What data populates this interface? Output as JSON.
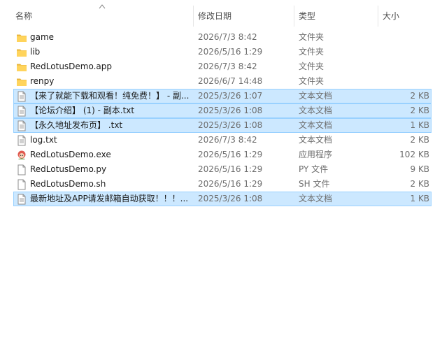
{
  "columns": {
    "name": "名称",
    "date": "修改日期",
    "type": "类型",
    "size": "大小"
  },
  "files": [
    {
      "name": "game",
      "date": "2026/7/3 8:42",
      "type": "文件夹",
      "size": "",
      "icon": "folder-icon",
      "selected": false
    },
    {
      "name": "lib",
      "date": "2026/5/16 1:29",
      "type": "文件夹",
      "size": "",
      "icon": "folder-icon",
      "selected": false
    },
    {
      "name": "RedLotusDemo.app",
      "date": "2026/7/3 8:42",
      "type": "文件夹",
      "size": "",
      "icon": "folder-icon",
      "selected": false
    },
    {
      "name": "renpy",
      "date": "2026/6/7 14:48",
      "type": "文件夹",
      "size": "",
      "icon": "folder-icon",
      "selected": false
    },
    {
      "name": "【来了就能下载和观看！纯免费！】 - 副...",
      "date": "2025/3/26 1:07",
      "type": "文本文档",
      "size": "2 KB",
      "icon": "text-document-icon",
      "selected": true
    },
    {
      "name": "【论坛介绍】 (1) - 副本.txt",
      "date": "2025/3/26 1:08",
      "type": "文本文档",
      "size": "2 KB",
      "icon": "text-document-icon",
      "selected": true
    },
    {
      "name": "【永久地址发布页】 .txt",
      "date": "2025/3/26 1:08",
      "type": "文本文档",
      "size": "1 KB",
      "icon": "text-document-icon",
      "selected": true
    },
    {
      "name": "log.txt",
      "date": "2026/7/3 8:42",
      "type": "文本文档",
      "size": "2 KB",
      "icon": "text-document-icon",
      "selected": false
    },
    {
      "name": "RedLotusDemo.exe",
      "date": "2026/5/16 1:29",
      "type": "应用程序",
      "size": "102 KB",
      "icon": "application-icon",
      "selected": false
    },
    {
      "name": "RedLotusDemo.py",
      "date": "2026/5/16 1:29",
      "type": "PY 文件",
      "size": "9 KB",
      "icon": "blank-file-icon",
      "selected": false
    },
    {
      "name": "RedLotusDemo.sh",
      "date": "2026/5/16 1:29",
      "type": "SH 文件",
      "size": "2 KB",
      "icon": "blank-file-icon",
      "selected": false
    },
    {
      "name": "最新地址及APP请发邮箱自动获取！！！...",
      "date": "2025/3/26 1:08",
      "type": "文本文档",
      "size": "1 KB",
      "icon": "text-document-icon",
      "selected": true
    }
  ],
  "colors": {
    "selection_bg": "#cce8ff",
    "selection_border": "#99d1ff",
    "folder": "#ffd45c"
  }
}
